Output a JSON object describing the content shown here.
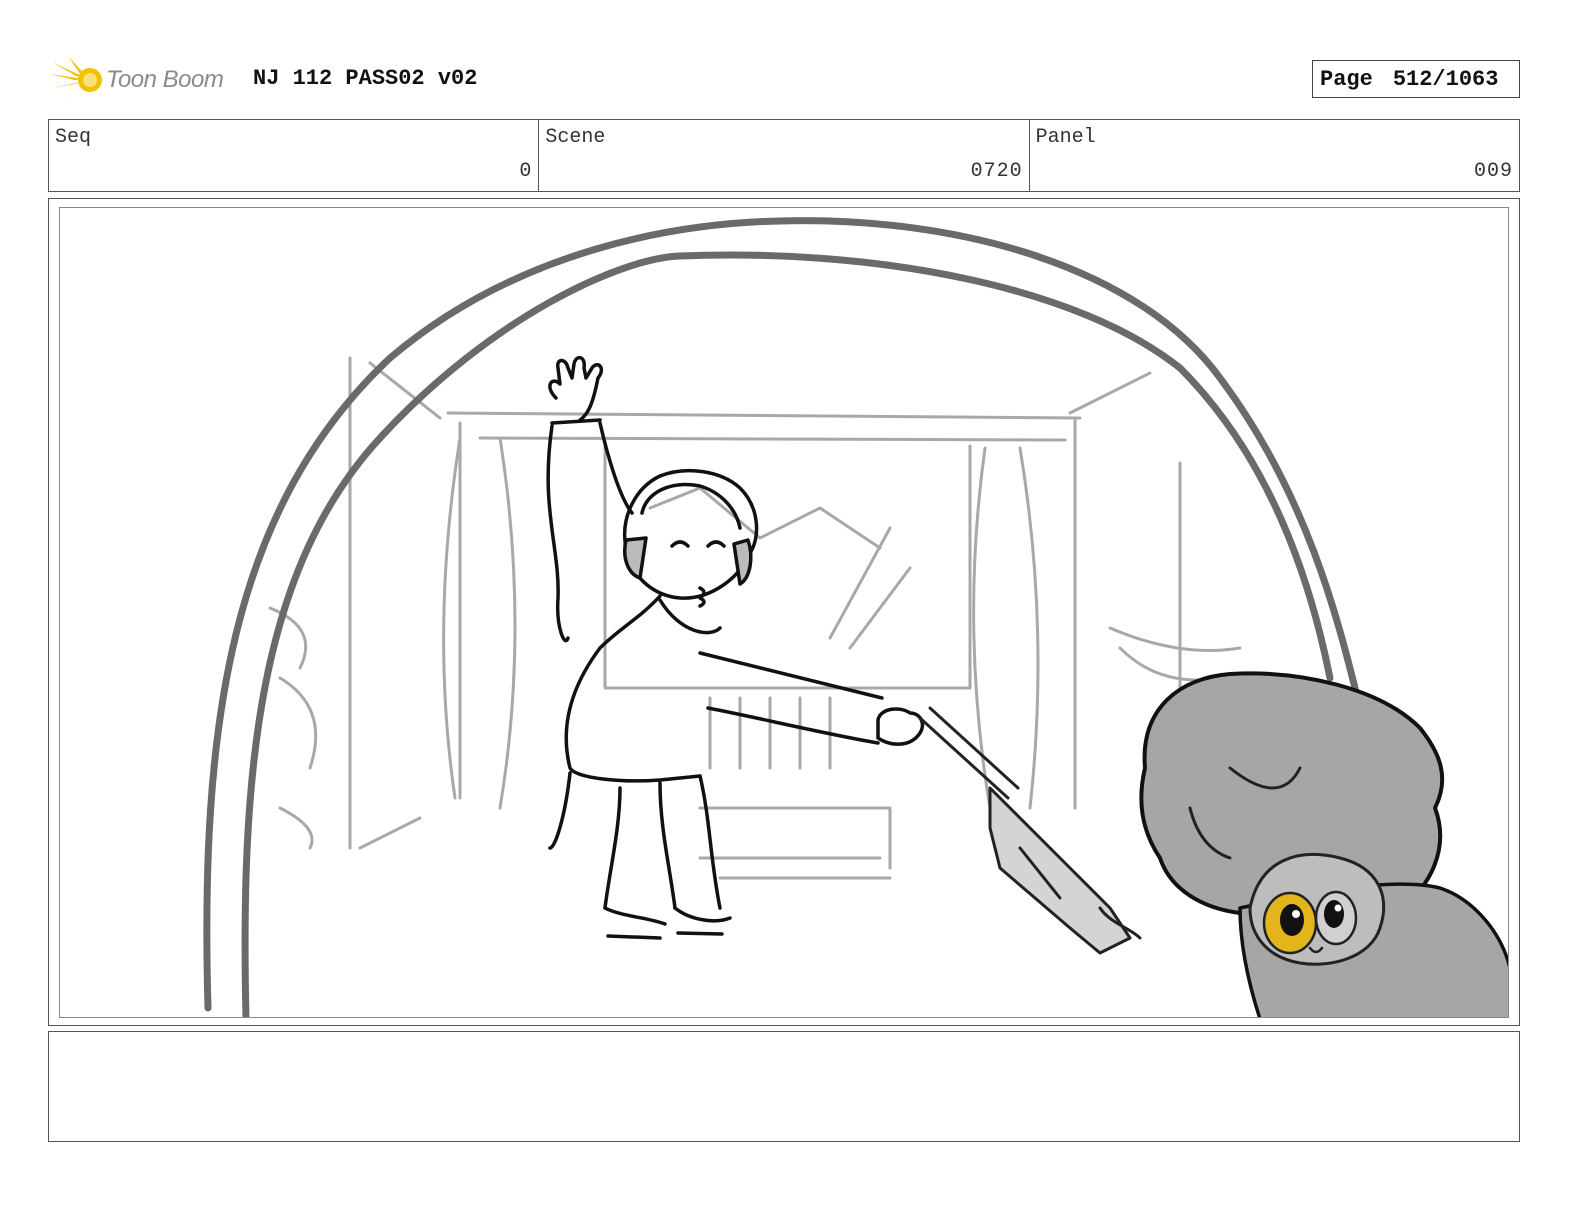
{
  "header": {
    "logo_text": "Toon Boom",
    "title": "NJ 112 PASS02 v02",
    "page_label": "Page",
    "page_value": "512/1063"
  },
  "info": {
    "seq_label": "Seq",
    "seq_value": "0",
    "scene_label": "Scene",
    "scene_value": "0720",
    "panel_label": "Panel",
    "panel_value": "009"
  },
  "notes": {
    "text": ""
  },
  "colors": {
    "logo_accent": "#f2c200",
    "sketch_line": "#222222",
    "background_line": "#a8a8a8",
    "creature_fill": "#a6a6a6",
    "eye_highlight": "#e3b51c"
  }
}
